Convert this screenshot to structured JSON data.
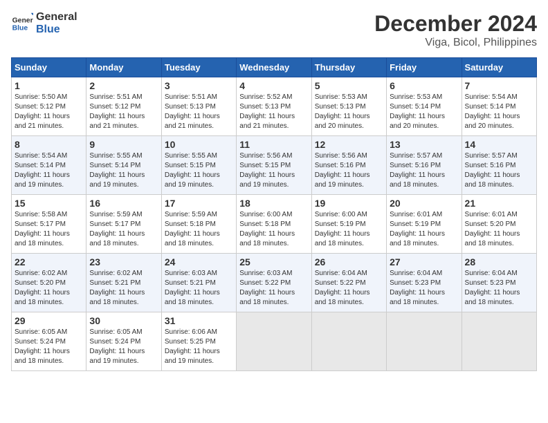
{
  "header": {
    "logo_line1": "General",
    "logo_line2": "Blue",
    "month": "December 2024",
    "location": "Viga, Bicol, Philippines"
  },
  "days_of_week": [
    "Sunday",
    "Monday",
    "Tuesday",
    "Wednesday",
    "Thursday",
    "Friday",
    "Saturday"
  ],
  "weeks": [
    [
      {
        "day": "1",
        "info": "Sunrise: 5:50 AM\nSunset: 5:12 PM\nDaylight: 11 hours\nand 21 minutes."
      },
      {
        "day": "2",
        "info": "Sunrise: 5:51 AM\nSunset: 5:12 PM\nDaylight: 11 hours\nand 21 minutes."
      },
      {
        "day": "3",
        "info": "Sunrise: 5:51 AM\nSunset: 5:13 PM\nDaylight: 11 hours\nand 21 minutes."
      },
      {
        "day": "4",
        "info": "Sunrise: 5:52 AM\nSunset: 5:13 PM\nDaylight: 11 hours\nand 21 minutes."
      },
      {
        "day": "5",
        "info": "Sunrise: 5:53 AM\nSunset: 5:13 PM\nDaylight: 11 hours\nand 20 minutes."
      },
      {
        "day": "6",
        "info": "Sunrise: 5:53 AM\nSunset: 5:14 PM\nDaylight: 11 hours\nand 20 minutes."
      },
      {
        "day": "7",
        "info": "Sunrise: 5:54 AM\nSunset: 5:14 PM\nDaylight: 11 hours\nand 20 minutes."
      }
    ],
    [
      {
        "day": "8",
        "info": "Sunrise: 5:54 AM\nSunset: 5:14 PM\nDaylight: 11 hours\nand 19 minutes."
      },
      {
        "day": "9",
        "info": "Sunrise: 5:55 AM\nSunset: 5:14 PM\nDaylight: 11 hours\nand 19 minutes."
      },
      {
        "day": "10",
        "info": "Sunrise: 5:55 AM\nSunset: 5:15 PM\nDaylight: 11 hours\nand 19 minutes."
      },
      {
        "day": "11",
        "info": "Sunrise: 5:56 AM\nSunset: 5:15 PM\nDaylight: 11 hours\nand 19 minutes."
      },
      {
        "day": "12",
        "info": "Sunrise: 5:56 AM\nSunset: 5:16 PM\nDaylight: 11 hours\nand 19 minutes."
      },
      {
        "day": "13",
        "info": "Sunrise: 5:57 AM\nSunset: 5:16 PM\nDaylight: 11 hours\nand 18 minutes."
      },
      {
        "day": "14",
        "info": "Sunrise: 5:57 AM\nSunset: 5:16 PM\nDaylight: 11 hours\nand 18 minutes."
      }
    ],
    [
      {
        "day": "15",
        "info": "Sunrise: 5:58 AM\nSunset: 5:17 PM\nDaylight: 11 hours\nand 18 minutes."
      },
      {
        "day": "16",
        "info": "Sunrise: 5:59 AM\nSunset: 5:17 PM\nDaylight: 11 hours\nand 18 minutes."
      },
      {
        "day": "17",
        "info": "Sunrise: 5:59 AM\nSunset: 5:18 PM\nDaylight: 11 hours\nand 18 minutes."
      },
      {
        "day": "18",
        "info": "Sunrise: 6:00 AM\nSunset: 5:18 PM\nDaylight: 11 hours\nand 18 minutes."
      },
      {
        "day": "19",
        "info": "Sunrise: 6:00 AM\nSunset: 5:19 PM\nDaylight: 11 hours\nand 18 minutes."
      },
      {
        "day": "20",
        "info": "Sunrise: 6:01 AM\nSunset: 5:19 PM\nDaylight: 11 hours\nand 18 minutes."
      },
      {
        "day": "21",
        "info": "Sunrise: 6:01 AM\nSunset: 5:20 PM\nDaylight: 11 hours\nand 18 minutes."
      }
    ],
    [
      {
        "day": "22",
        "info": "Sunrise: 6:02 AM\nSunset: 5:20 PM\nDaylight: 11 hours\nand 18 minutes."
      },
      {
        "day": "23",
        "info": "Sunrise: 6:02 AM\nSunset: 5:21 PM\nDaylight: 11 hours\nand 18 minutes."
      },
      {
        "day": "24",
        "info": "Sunrise: 6:03 AM\nSunset: 5:21 PM\nDaylight: 11 hours\nand 18 minutes."
      },
      {
        "day": "25",
        "info": "Sunrise: 6:03 AM\nSunset: 5:22 PM\nDaylight: 11 hours\nand 18 minutes."
      },
      {
        "day": "26",
        "info": "Sunrise: 6:04 AM\nSunset: 5:22 PM\nDaylight: 11 hours\nand 18 minutes."
      },
      {
        "day": "27",
        "info": "Sunrise: 6:04 AM\nSunset: 5:23 PM\nDaylight: 11 hours\nand 18 minutes."
      },
      {
        "day": "28",
        "info": "Sunrise: 6:04 AM\nSunset: 5:23 PM\nDaylight: 11 hours\nand 18 minutes."
      }
    ],
    [
      {
        "day": "29",
        "info": "Sunrise: 6:05 AM\nSunset: 5:24 PM\nDaylight: 11 hours\nand 18 minutes."
      },
      {
        "day": "30",
        "info": "Sunrise: 6:05 AM\nSunset: 5:24 PM\nDaylight: 11 hours\nand 19 minutes."
      },
      {
        "day": "31",
        "info": "Sunrise: 6:06 AM\nSunset: 5:25 PM\nDaylight: 11 hours\nand 19 minutes."
      },
      {
        "day": "",
        "info": ""
      },
      {
        "day": "",
        "info": ""
      },
      {
        "day": "",
        "info": ""
      },
      {
        "day": "",
        "info": ""
      }
    ]
  ]
}
